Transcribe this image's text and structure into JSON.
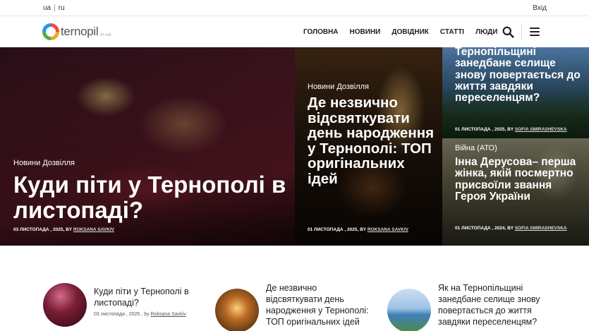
{
  "topbar": {
    "lang_ua": "ua",
    "lang_sep": "|",
    "lang_ru": "ru",
    "login": "Вхід"
  },
  "logo": {
    "text": "ternopil",
    "tld": ".in.ua"
  },
  "nav": {
    "items": [
      "ГОЛОВНА",
      "НОВИНИ",
      "ДОВІДНИК",
      "СТАТТІ",
      "ЛЮДИ"
    ]
  },
  "icons": {
    "search": "search-icon",
    "menu": "hamburger-menu-icon"
  },
  "hero": {
    "main": {
      "category": "Новини Дозвілля",
      "title": "Куди піти у Тернополі в листопаді?",
      "date": "03 ЛИСТОПАДА , 2025, BY",
      "author": "ROKSANA SAVKIV"
    },
    "middle": {
      "category": "Новини Дозвілля",
      "title": "Де незвично відсвяткувати день народження у Тернополі: ТОП оригінальних ідей",
      "date": "01 ЛИСТОПАДА , 2025, BY",
      "author": "ROKSANA SAVKIV"
    },
    "top_right": {
      "title": "Тернопільщині занедбане селище знову повертається до життя завдяки переселенцям?",
      "date": "01 ЛИСТОПАДА , 2025, BY",
      "author": "SOFIA SMIRASHEVSKA"
    },
    "bottom_right": {
      "category": "Війна (АТО)",
      "title": "Інна Дерусова– перша жінка, якій посмертно присвоїли звання Героя України",
      "date": "01 ЛИСТОПАДА , 2024, BY",
      "author": "SOFIA SMIRASHEVSKA"
    }
  },
  "list": {
    "items": [
      {
        "title": "Куди піти у Тернополі в листопаді?",
        "date": "03 листопада , 2025 , by",
        "author": "Roksana Savkiv"
      },
      {
        "title": "Де незвично відсвяткувати день народження у Тернополі: ТОП оригінальних ідей"
      },
      {
        "title": "Як на Тернопільщині занедбане селище знову повертається до життя завдяки переселенцям?"
      }
    ]
  }
}
